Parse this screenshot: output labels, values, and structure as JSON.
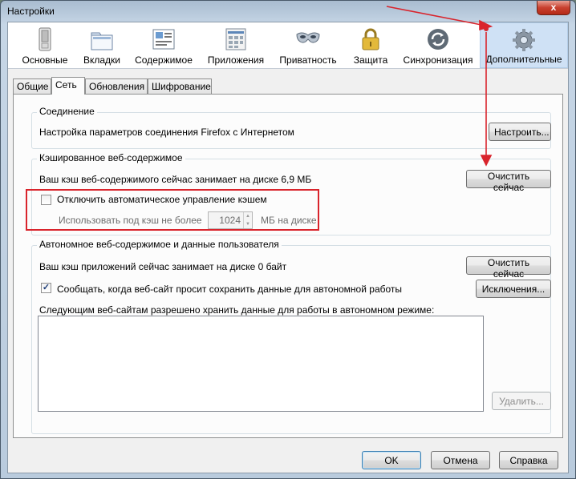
{
  "window": {
    "title": "Настройки",
    "close_glyph": "x"
  },
  "toolbar": {
    "panes": [
      {
        "label": "Основные",
        "icon": "switch-icon"
      },
      {
        "label": "Вкладки",
        "icon": "tabs-icon"
      },
      {
        "label": "Содержимое",
        "icon": "content-icon"
      },
      {
        "label": "Приложения",
        "icon": "applications-icon"
      },
      {
        "label": "Приватность",
        "icon": "mask-icon"
      },
      {
        "label": "Защита",
        "icon": "padlock-icon"
      },
      {
        "label": "Синхронизация",
        "icon": "sync-icon"
      },
      {
        "label": "Дополнительные",
        "icon": "gear-icon",
        "selected": true
      }
    ]
  },
  "tabs": [
    {
      "label": "Общие"
    },
    {
      "label": "Сеть",
      "active": true
    },
    {
      "label": "Обновления"
    },
    {
      "label": "Шифрование"
    }
  ],
  "connection": {
    "title": "Соединение",
    "text": "Настройка параметров соединения Firefox с Интернетом",
    "button": "Настроить..."
  },
  "cache": {
    "title": "Кэшированное веб-содержимое",
    "text": "Ваш кэш веб-содержимого сейчас занимает на диске 6,9 МБ",
    "button": "Очистить сейчас",
    "override_label": "Отключить автоматическое управление кэшем",
    "override_checked": false,
    "limit_label": "Использовать под кэш не более",
    "limit_value": "1024",
    "limit_unit": "МБ на диске"
  },
  "offline": {
    "title": "Автономное веб-содержимое и данные пользователя",
    "text": "Ваш кэш приложений сейчас занимает на диске 0 байт",
    "clear_button": "Очистить сейчас",
    "notify_label": "Сообщать, когда веб-сайт просит сохранить данные для автономной работы",
    "notify_checked": true,
    "exceptions_button": "Исключения...",
    "list_label": "Следующим веб-сайтам разрешено хранить данные для работы в автономном режиме:",
    "remove_button": "Удалить...",
    "sites": []
  },
  "dialog": {
    "ok": "OK",
    "cancel": "Отмена",
    "help": "Справка"
  },
  "annotation_color": "#d9242c"
}
